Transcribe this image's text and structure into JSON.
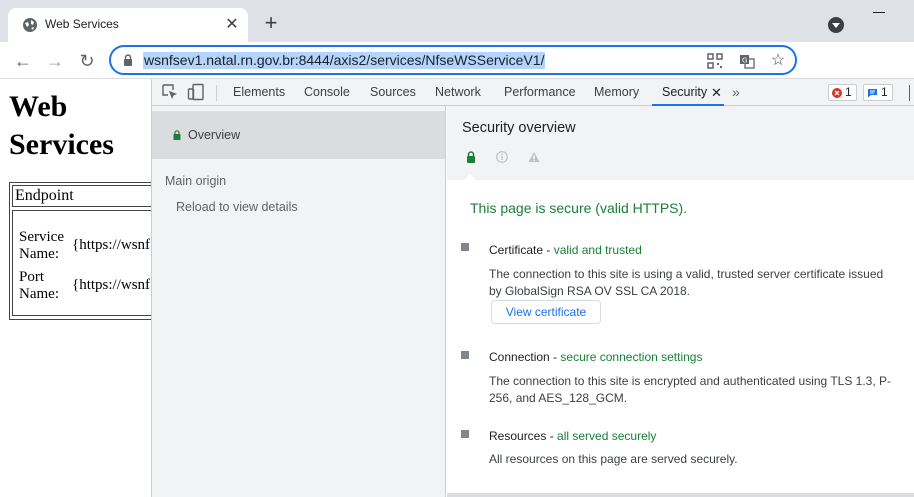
{
  "browser": {
    "tab_title": "Web Services",
    "tab_close": "✕",
    "new_tab": "+",
    "url": "wsnfsev1.natal.rn.gov.br:8444/axis2/services/NfseWSServiceV1/",
    "back": "←",
    "forward": "→",
    "reload": "↻"
  },
  "page": {
    "title": "Web Services",
    "table_header": "Endpoint",
    "rows": [
      {
        "label": "Service Name:",
        "value": "{https://wsnf"
      },
      {
        "label": "Port Name:",
        "value": "{https://wsnf"
      }
    ]
  },
  "devtools": {
    "tabs": [
      "Elements",
      "Console",
      "Sources",
      "Network",
      "Performance",
      "Memory",
      "Security"
    ],
    "active_tab": "Security",
    "close": "✕",
    "more": "»",
    "errors": "1",
    "messages": "1",
    "sidebar": {
      "overview": "Overview",
      "main_origin": "Main origin",
      "reload": "Reload to view details"
    },
    "security": {
      "title": "Security overview",
      "secure_text": "This page is secure (valid HTTPS).",
      "certificate": {
        "title": "Certificate",
        "sep": " - ",
        "status": "valid and trusted",
        "desc": "The connection to this site is using a valid, trusted server certificate issued by GlobalSign RSA OV SSL CA 2018.",
        "button": "View certificate"
      },
      "connection": {
        "title": "Connection",
        "sep": " - ",
        "status": "secure connection settings",
        "desc": "The connection to this site is encrypted and authenticated using TLS 1.3, P-256, and AES_128_GCM."
      },
      "resources": {
        "title": "Resources",
        "sep": " - ",
        "status": "all served securely",
        "desc": "All resources on this page are served securely."
      }
    }
  },
  "colors": {
    "accent": "#1a73e8",
    "secure_green": "#188038",
    "error_red": "#d93025"
  }
}
